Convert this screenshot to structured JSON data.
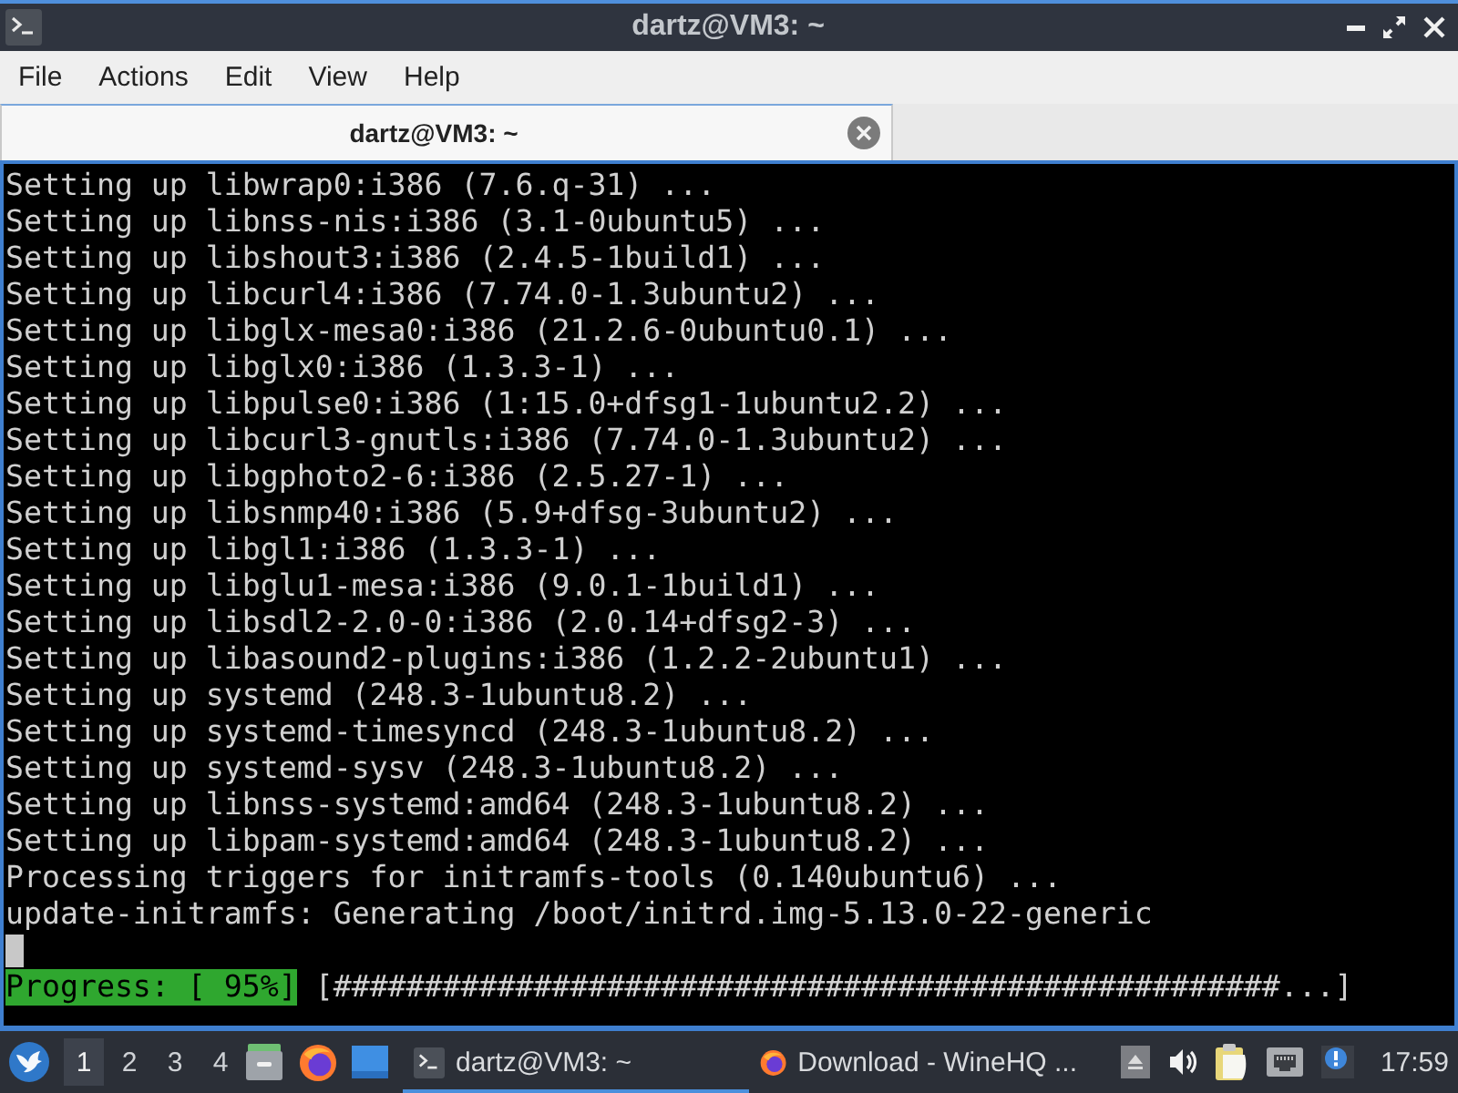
{
  "window": {
    "title": "dartz@VM3: ~"
  },
  "menu": [
    "File",
    "Actions",
    "Edit",
    "View",
    "Help"
  ],
  "tabs": [
    {
      "label": "dartz@VM3: ~",
      "selected": true
    }
  ],
  "terminal": {
    "lines": [
      "Setting up libwrap0:i386 (7.6.q-31) ...",
      "Setting up libnss-nis:i386 (3.1-0ubuntu5) ...",
      "Setting up libshout3:i386 (2.4.5-1build1) ...",
      "Setting up libcurl4:i386 (7.74.0-1.3ubuntu2) ...",
      "Setting up libglx-mesa0:i386 (21.2.6-0ubuntu0.1) ...",
      "Setting up libglx0:i386 (1.3.3-1) ...",
      "Setting up libpulse0:i386 (1:15.0+dfsg1-1ubuntu2.2) ...",
      "Setting up libcurl3-gnutls:i386 (7.74.0-1.3ubuntu2) ...",
      "Setting up libgphoto2-6:i386 (2.5.27-1) ...",
      "Setting up libsnmp40:i386 (5.9+dfsg-3ubuntu2) ...",
      "Setting up libgl1:i386 (1.3.3-1) ...",
      "Setting up libglu1-mesa:i386 (9.0.1-1build1) ...",
      "Setting up libsdl2-2.0-0:i386 (2.0.14+dfsg2-3) ...",
      "Setting up libasound2-plugins:i386 (1.2.2-2ubuntu1) ...",
      "Setting up systemd (248.3-1ubuntu8.2) ...",
      "Setting up systemd-timesyncd (248.3-1ubuntu8.2) ...",
      "Setting up systemd-sysv (248.3-1ubuntu8.2) ...",
      "Setting up libnss-systemd:amd64 (248.3-1ubuntu8.2) ...",
      "Setting up libpam-systemd:amd64 (248.3-1ubuntu8.2) ...",
      "Processing triggers for initramfs-tools (0.140ubuntu6) ...",
      "update-initramfs: Generating /boot/initrd.img-5.13.0-22-generic"
    ],
    "progress": {
      "label": "Progress: [ 95%]",
      "bar": "[####################################################...]"
    }
  },
  "taskbar": {
    "workspaces": [
      {
        "label": "1",
        "selected": true
      },
      {
        "label": "2",
        "selected": false
      },
      {
        "label": "3",
        "selected": false
      },
      {
        "label": "4",
        "selected": false
      }
    ],
    "tasks": [
      {
        "kind": "terminal",
        "label": "dartz@VM3: ~",
        "selected": true
      },
      {
        "kind": "browser",
        "label": "Download - WineHQ ...",
        "selected": false
      }
    ],
    "clock": "17:59"
  }
}
